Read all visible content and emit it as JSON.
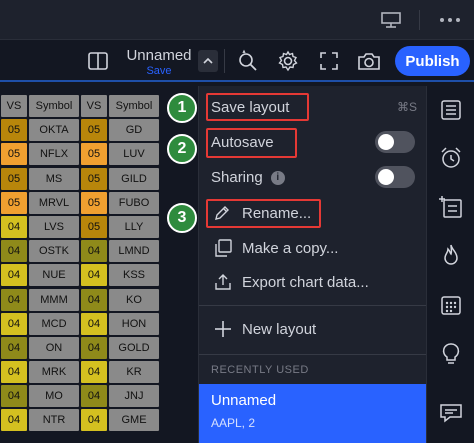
{
  "toolbar": {
    "layout_name": "Unnamed",
    "save_label": "Save",
    "publish_label": "Publish"
  },
  "table": {
    "headers": [
      "VS",
      "Symbol",
      "VS",
      "Symbol"
    ],
    "rows": [
      [
        "05",
        "OKTA",
        "05",
        "GD"
      ],
      [
        "05",
        "NFLX",
        "05",
        "LUV"
      ],
      [
        "05",
        "MS",
        "05",
        "GILD"
      ],
      [
        "05",
        "MRVL",
        "05",
        "FUBO"
      ],
      [
        "04",
        "LVS",
        "05",
        "LLY"
      ],
      [
        "04",
        "OSTK",
        "04",
        "LMND"
      ],
      [
        "04",
        "NUE",
        "04",
        "KSS"
      ],
      [
        "04",
        "MMM",
        "04",
        "KO"
      ],
      [
        "04",
        "MCD",
        "04",
        "HON"
      ],
      [
        "04",
        "ON",
        "04",
        "GOLD"
      ],
      [
        "04",
        "MRK",
        "04",
        "KR"
      ],
      [
        "04",
        "MO",
        "04",
        "JNJ"
      ],
      [
        "04",
        "NTR",
        "04",
        "GME"
      ]
    ],
    "colors": {
      "vs05_a": "#f0a030",
      "vs05_b": "#b8860b",
      "vs04_a": "#d4c020",
      "vs04_b": "#8f8a1a",
      "symbol": "#8a8a8a"
    }
  },
  "menu": {
    "save_layout": "Save layout",
    "save_shortcut": "⌘S",
    "autosave": "Autosave",
    "sharing": "Sharing",
    "info_glyph": "i",
    "rename": "Rename...",
    "make_copy": "Make a copy...",
    "export": "Export chart data...",
    "new_layout": "New layout",
    "recently_used": "RECENTLY USED",
    "recent_name": "Unnamed",
    "recent_sub": "AAPL, 2"
  },
  "annotations": {
    "badge1": "1",
    "badge2": "2",
    "badge3": "3",
    "badge_color": "#2e8b3d",
    "highlight_color": "#e53935"
  },
  "icons": {
    "topbar": [
      "monitor-icon",
      "more-icon"
    ],
    "toolbar": [
      "split-layout-icon",
      "chevron-up-icon",
      "magic-cursor-icon",
      "gear-icon",
      "fullscreen-icon",
      "camera-icon"
    ],
    "menu": [
      "pencil-icon",
      "copy-icon",
      "export-icon",
      "plus-icon"
    ],
    "sidebar": [
      "watchlist-icon",
      "alarm-icon",
      "add-list-icon",
      "fire-icon",
      "calendar-icon",
      "lightbulb-icon",
      "chat-icon"
    ]
  },
  "accent": "#2962ff"
}
